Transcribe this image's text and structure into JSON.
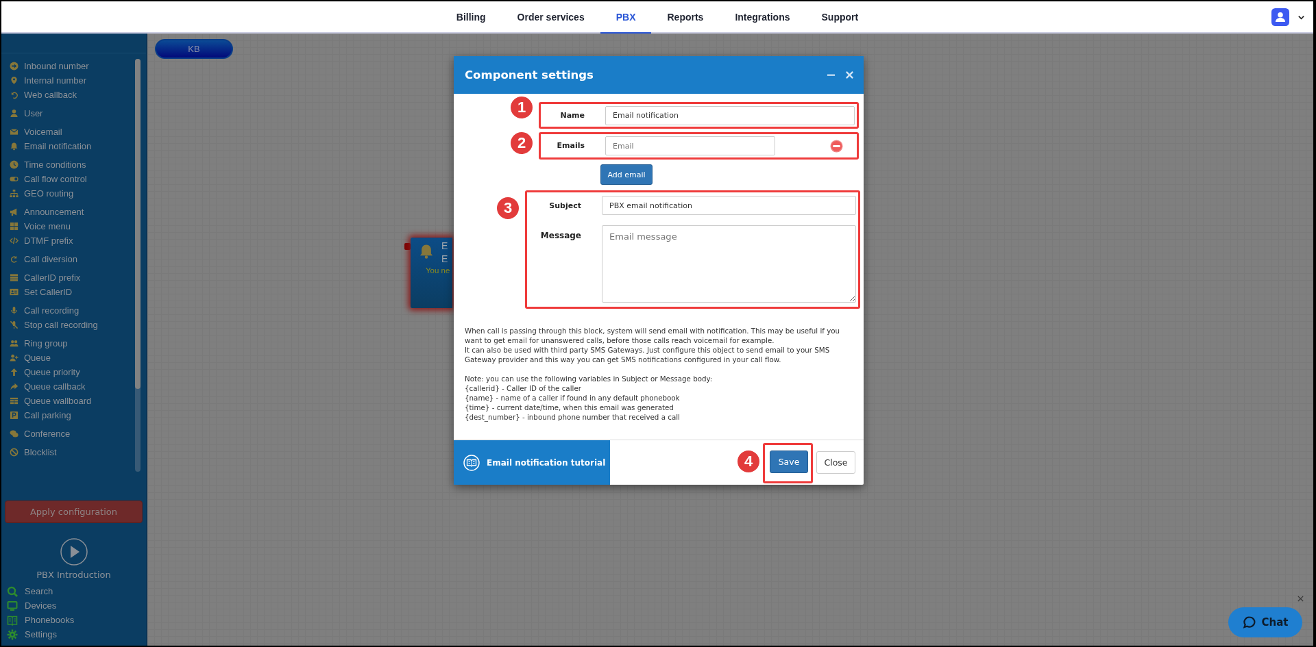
{
  "nav": {
    "tabs": [
      {
        "label": "Billing",
        "selected": false
      },
      {
        "label": "Order services",
        "selected": false
      },
      {
        "label": "PBX",
        "selected": true
      },
      {
        "label": "Reports",
        "selected": false
      },
      {
        "label": "Integrations",
        "selected": false
      },
      {
        "label": "Support",
        "selected": false
      }
    ]
  },
  "sidebar": {
    "groups": [
      {
        "items": [
          {
            "label": "Inbound number"
          },
          {
            "label": "Internal number"
          },
          {
            "label": "Web callback"
          }
        ]
      },
      {
        "items": [
          {
            "label": "User"
          }
        ]
      },
      {
        "items": [
          {
            "label": "Voicemail"
          },
          {
            "label": "Email notification"
          }
        ]
      },
      {
        "items": [
          {
            "label": "Time conditions"
          },
          {
            "label": "Call flow control"
          },
          {
            "label": "GEO routing"
          }
        ]
      },
      {
        "items": [
          {
            "label": "Announcement"
          },
          {
            "label": "Voice menu"
          },
          {
            "label": "DTMF prefix"
          }
        ]
      },
      {
        "items": [
          {
            "label": "Call diversion"
          }
        ]
      },
      {
        "items": [
          {
            "label": "CallerID prefix"
          },
          {
            "label": "Set CallerID"
          }
        ]
      },
      {
        "items": [
          {
            "label": "Call recording"
          },
          {
            "label": "Stop call recording"
          }
        ]
      },
      {
        "items": [
          {
            "label": "Ring group"
          },
          {
            "label": "Queue"
          },
          {
            "label": "Queue priority"
          },
          {
            "label": "Queue callback"
          },
          {
            "label": "Queue wallboard"
          },
          {
            "label": "Call parking"
          }
        ]
      },
      {
        "items": [
          {
            "label": "Conference"
          }
        ]
      },
      {
        "items": [
          {
            "label": "Blocklist"
          }
        ]
      }
    ],
    "apply_button": "Apply configuration",
    "intro": "PBX Introduction",
    "links": [
      {
        "label": "Search"
      },
      {
        "label": "Devices"
      },
      {
        "label": "Phonebooks"
      },
      {
        "label": "Settings"
      }
    ]
  },
  "canvas": {
    "kb_button": "KB",
    "node": {
      "lines": [
        "E",
        "E"
      ],
      "warning": "You ne"
    }
  },
  "modal": {
    "title": "Component settings",
    "name": {
      "marker": "1",
      "label": "Name",
      "value": "Email notification"
    },
    "emails": {
      "marker": "2",
      "label": "Emails",
      "placeholder": "Email"
    },
    "add_button": "Add email",
    "content": {
      "marker": "3",
      "subject": {
        "label": "Subject",
        "value": "PBX email notification"
      },
      "message": {
        "label": "Message",
        "placeholder": "Email message"
      }
    },
    "help": [
      [
        "When call is passing through this block, system will send email with notification. This may be useful if you want to get email for unanswered calls, before those calls reach voicemail for example.",
        "It can also be used with third party SMS Gateways. Just configure this object to send email to your SMS Gateway provider and this way you can get SMS notifications configured in your call flow."
      ],
      [
        "Note: you can use the following variables in Subject or Message body:",
        "{callerid} - Caller ID of the caller",
        "{name} - name of a caller if found in any default phonebook",
        "{time} - current date/time, when this email was generated",
        "{dest_number} - inbound phone number that received a call"
      ]
    ],
    "tutorial": "Email notification tutorial",
    "save": {
      "marker": "4",
      "label": "Save"
    },
    "close": "Close"
  },
  "chat": {
    "label": "Chat"
  }
}
